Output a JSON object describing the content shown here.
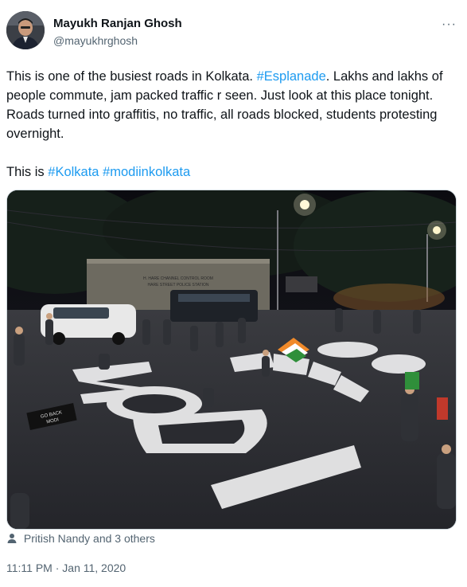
{
  "author": {
    "display_name": "Mayukh Ranjan Ghosh",
    "handle": "@mayukhrghosh",
    "avatar_icon": "avatar-photo-icon"
  },
  "more_icon": "more-horizontal-icon",
  "tweet": {
    "segments": [
      {
        "text": "This is one of the busiest roads in Kolkata. ",
        "link": false
      },
      {
        "text": "#Esplanade",
        "link": true
      },
      {
        "text": ". Lakhs and lakhs of people commute, jam packed traffic r seen. Just look at this place tonight. Roads turned into graffitis, no traffic, all roads blocked, students protesting overnight.",
        "link": false
      }
    ],
    "second_para": [
      {
        "text": "This is ",
        "link": false
      },
      {
        "text": "#Kolkata",
        "link": true
      },
      {
        "text": " ",
        "link": false
      },
      {
        "text": "#modiinkolkata",
        "link": true
      }
    ]
  },
  "photo": {
    "painted_words": [
      "MODI",
      "GO",
      "BACK"
    ],
    "building_sign": "H. HARE CHANNEL CONTROL ROOM\nHARE STREET POLICE STATION",
    "placard_text": "GO BACK\nMODI",
    "colors": {
      "link": "#1d9bf0",
      "secondary": "#536471",
      "border": "#cfd9de"
    }
  },
  "likes": {
    "icon": "person-icon",
    "text": "Pritish Nandy and 3 others"
  },
  "timestamp": "11:11 PM · Jan 11, 2020"
}
